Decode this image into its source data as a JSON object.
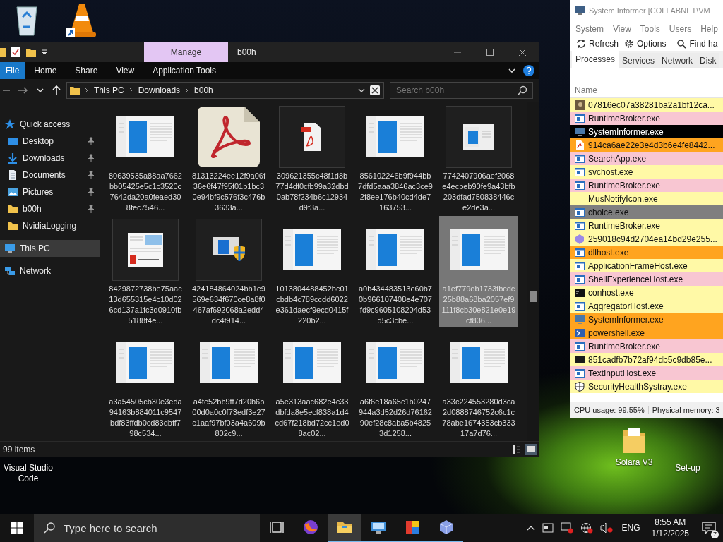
{
  "desktop_icons": [
    {
      "label": "Visual Studio Code",
      "kind": "label-only"
    },
    {
      "label": "Solara V3",
      "kind": "folder"
    },
    {
      "label": "Set-up",
      "kind": "label-only"
    }
  ],
  "explorer": {
    "context_tab": "Manage",
    "title": "b00h",
    "file_tab": "File",
    "ribbon_tabs": [
      "Home",
      "Share",
      "View",
      "Application Tools"
    ],
    "breadcrumbs": [
      "This PC",
      "Downloads",
      "b00h"
    ],
    "search": {
      "placeholder": "Search b00h"
    },
    "sidebar": [
      {
        "label": "Quick access",
        "kind": "star",
        "selected": false,
        "children": [
          {
            "label": "Desktop",
            "kind": "desktop",
            "pinned": true,
            "selected": false
          },
          {
            "label": "Downloads",
            "kind": "download",
            "pinned": true,
            "selected": false
          },
          {
            "label": "Documents",
            "kind": "documents",
            "pinned": true,
            "selected": false
          },
          {
            "label": "Pictures",
            "kind": "pictures",
            "pinned": true,
            "selected": false
          },
          {
            "label": "b00h",
            "kind": "folder",
            "pinned": true,
            "selected": false
          },
          {
            "label": "NvidiaLogging",
            "kind": "folder",
            "pinned": false,
            "selected": false
          }
        ]
      },
      {
        "label": "This PC",
        "kind": "pc",
        "selected": true
      },
      {
        "label": "Network",
        "kind": "network",
        "selected": false
      }
    ],
    "files": [
      {
        "name": "80639535a88aa7662bb05425e5c1c3520c7642da20a0feaed308fec7546...",
        "kind": "window",
        "selected": false
      },
      {
        "name": "81313224ee12f9a06f36e6f47f95f01b1bc30e94bf9c576f3c476b3633a...",
        "kind": "pdf-large",
        "selected": false
      },
      {
        "name": "309621355c48f1d8b77d4df0cfb99a32dbd0ab78f234b6c12934d9f3a...",
        "kind": "pdf-small",
        "selected": false
      },
      {
        "name": "856102246b9f944bb7dfd5aaa3846ac3ce92f8ee176b40cd4de7163753...",
        "kind": "window",
        "selected": false
      },
      {
        "name": "7742407906aef2068e4ecbeb90fe9a43bfb203dfad750838446ce2de3a...",
        "kind": "window-small",
        "selected": false
      },
      {
        "name": "8429872738be75aac13d655315e4c10d026cd137a1fc3d0910fb5188f4e...",
        "kind": "screenshot",
        "selected": false
      },
      {
        "name": "424184864024bb1e9569e634f670ce8a8f0467af692068a2edd4dc4f914...",
        "kind": "shield-window",
        "selected": false
      },
      {
        "name": "1013804488452bc01cbdb4c789ccdd6022e361daecf9ecd0415f220b2...",
        "kind": "window",
        "selected": false
      },
      {
        "name": "a0b434483513e60b70b966107408e4e707fd9c9605108204d53d5c3cbe...",
        "kind": "window",
        "selected": false
      },
      {
        "name": "a1ef779eb1733fbcdc25b88a68ba2057ef9111f8cb30e821e0e19cf836...",
        "kind": "window",
        "selected": true
      },
      {
        "name": "a3a54505cb30e3eda94163b884011c9547bdf83ffdb0cd83dbff798c534...",
        "kind": "window",
        "selected": false
      },
      {
        "name": "a4fe52bb9ff7d20b6b00d0a0c0f73edf3e27c1aaf97bf03a4a609b802c9...",
        "kind": "window",
        "selected": false
      },
      {
        "name": "a5e313aac682e4c33dbfda8e5ecf838a1d4cd67f218bd72cc1ed08ac02...",
        "kind": "window",
        "selected": false
      },
      {
        "name": "a6f6e18a65c1b0247944a3d52d26d7616290ef28c8aba5b48253d1258...",
        "kind": "window",
        "selected": false
      },
      {
        "name": "a33c224553280d3ca2d0888746752c6c1c78abe1674353cb33317a7d76...",
        "kind": "window",
        "selected": false
      }
    ],
    "status": "99 items"
  },
  "system_informer": {
    "title": "System Informer [COLLABNET\\VM",
    "menu": [
      "System",
      "View",
      "Tools",
      "Users",
      "Help"
    ],
    "toolbar": [
      {
        "label": "Refresh",
        "kind": "refresh"
      },
      {
        "label": "Options",
        "kind": "gear"
      },
      {
        "label": "Find ha",
        "kind": "search"
      }
    ],
    "tabs": [
      {
        "label": "Processes",
        "selected": true
      },
      {
        "label": "Services",
        "selected": false
      },
      {
        "label": "Network",
        "selected": false
      },
      {
        "label": "Disk",
        "selected": false
      }
    ],
    "column": "Name",
    "processes": [
      {
        "name": "07816ec07a38281ba2a1bf12ca...",
        "kind": "photo",
        "color": "#fff9a6",
        "selected": false
      },
      {
        "name": "RuntimeBroker.exe",
        "kind": "exe",
        "color": "#f8c6d2",
        "selected": false
      },
      {
        "name": "SystemInformer.exe",
        "kind": "monitor",
        "selected": true
      },
      {
        "name": "914ca6ae22e3e4d3b6e4fe8442...",
        "kind": "pdf",
        "color": "#ffa41f",
        "selected": false
      },
      {
        "name": "SearchApp.exe",
        "kind": "exe",
        "color": "#f8c6d2",
        "selected": false
      },
      {
        "name": "svchost.exe",
        "kind": "exe",
        "color": "#fff9a6",
        "selected": false
      },
      {
        "name": "RuntimeBroker.exe",
        "kind": "exe",
        "color": "#f8c6d2",
        "selected": false
      },
      {
        "name": "MusNotifyIcon.exe",
        "kind": "none",
        "color": "#fff9a6",
        "selected": false
      },
      {
        "name": "choice.exe",
        "kind": "exe",
        "color": "#7f7f7f",
        "selected": false
      },
      {
        "name": "RuntimeBroker.exe",
        "kind": "exe",
        "color": "#fff9a6",
        "selected": false
      },
      {
        "name": "259018c94d2704ea14bd29e255...",
        "kind": "gem",
        "color": "#fff9a6",
        "selected": false
      },
      {
        "name": "dllhost.exe",
        "kind": "exe",
        "color": "#ffa41f",
        "selected": false
      },
      {
        "name": "ApplicationFrameHost.exe",
        "kind": "exe",
        "color": "#fff9a6",
        "selected": false
      },
      {
        "name": "ShellExperienceHost.exe",
        "kind": "exe",
        "color": "#f8c6d2",
        "selected": false
      },
      {
        "name": "conhost.exe",
        "kind": "console",
        "color": "#fff9a6",
        "selected": false
      },
      {
        "name": "AggregatorHost.exe",
        "kind": "exe",
        "color": "#fff9a6",
        "selected": false
      },
      {
        "name": "SystemInformer.exe",
        "kind": "monitor",
        "color": "#ffa41f",
        "selected": false
      },
      {
        "name": "powershell.exe",
        "kind": "terminal",
        "color": "#ffa41f",
        "selected": false
      },
      {
        "name": "RuntimeBroker.exe",
        "kind": "exe",
        "color": "#f8c6d2",
        "selected": false
      },
      {
        "name": "851cadfb7b72af94db5c9db85e...",
        "kind": "dark",
        "color": "#fff9a6",
        "selected": false
      },
      {
        "name": "TextInputHost.exe",
        "kind": "exe",
        "color": "#f8c6d2",
        "selected": false
      },
      {
        "name": "SecurityHealthSystray.exe",
        "kind": "shield",
        "color": "#fff9a6",
        "selected": false
      }
    ],
    "status": [
      "CPU usage: 99.55%",
      "Physical memory: 3"
    ]
  },
  "taskbar": {
    "search": {
      "placeholder": "Type here to search"
    },
    "apps": [
      {
        "kind": "task-view",
        "running": false,
        "active": false
      },
      {
        "kind": "browser",
        "running": false,
        "active": false
      },
      {
        "kind": "folder",
        "running": true,
        "active": true
      },
      {
        "kind": "remote",
        "running": true,
        "active": false
      },
      {
        "kind": "gallery",
        "running": true,
        "active": false
      },
      {
        "kind": "cube",
        "running": true,
        "active": false
      }
    ],
    "language": "ENG",
    "time": "8:55 AM",
    "date": "1/12/2025",
    "notifications": "7"
  }
}
